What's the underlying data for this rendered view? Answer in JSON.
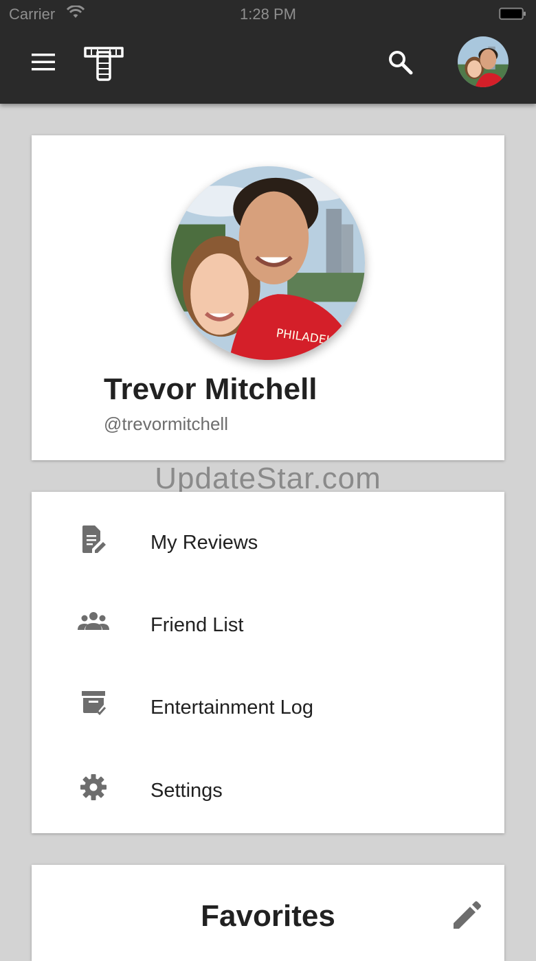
{
  "status_bar": {
    "carrier": "Carrier",
    "time": "1:28 PM"
  },
  "header": {
    "menu_icon": "hamburger-menu-icon",
    "logo_icon": "app-logo-icon",
    "search_icon": "search-icon",
    "avatar": "user-avatar"
  },
  "profile": {
    "name": "Trevor Mitchell",
    "handle": "@trevormitchell"
  },
  "watermark": "UpdateStar.com",
  "menu": {
    "items": [
      {
        "label": "My Reviews",
        "icon": "reviews-icon"
      },
      {
        "label": "Friend List",
        "icon": "friends-icon"
      },
      {
        "label": "Entertainment Log",
        "icon": "archive-check-icon"
      },
      {
        "label": "Settings",
        "icon": "gear-icon"
      }
    ]
  },
  "favorites": {
    "title": "Favorites",
    "edit_icon": "pencil-icon"
  },
  "colors": {
    "header_bg": "#2a2a2a",
    "page_bg": "#d3d3d3",
    "card_bg": "#ffffff",
    "icon_gray": "#6d6d6d"
  }
}
